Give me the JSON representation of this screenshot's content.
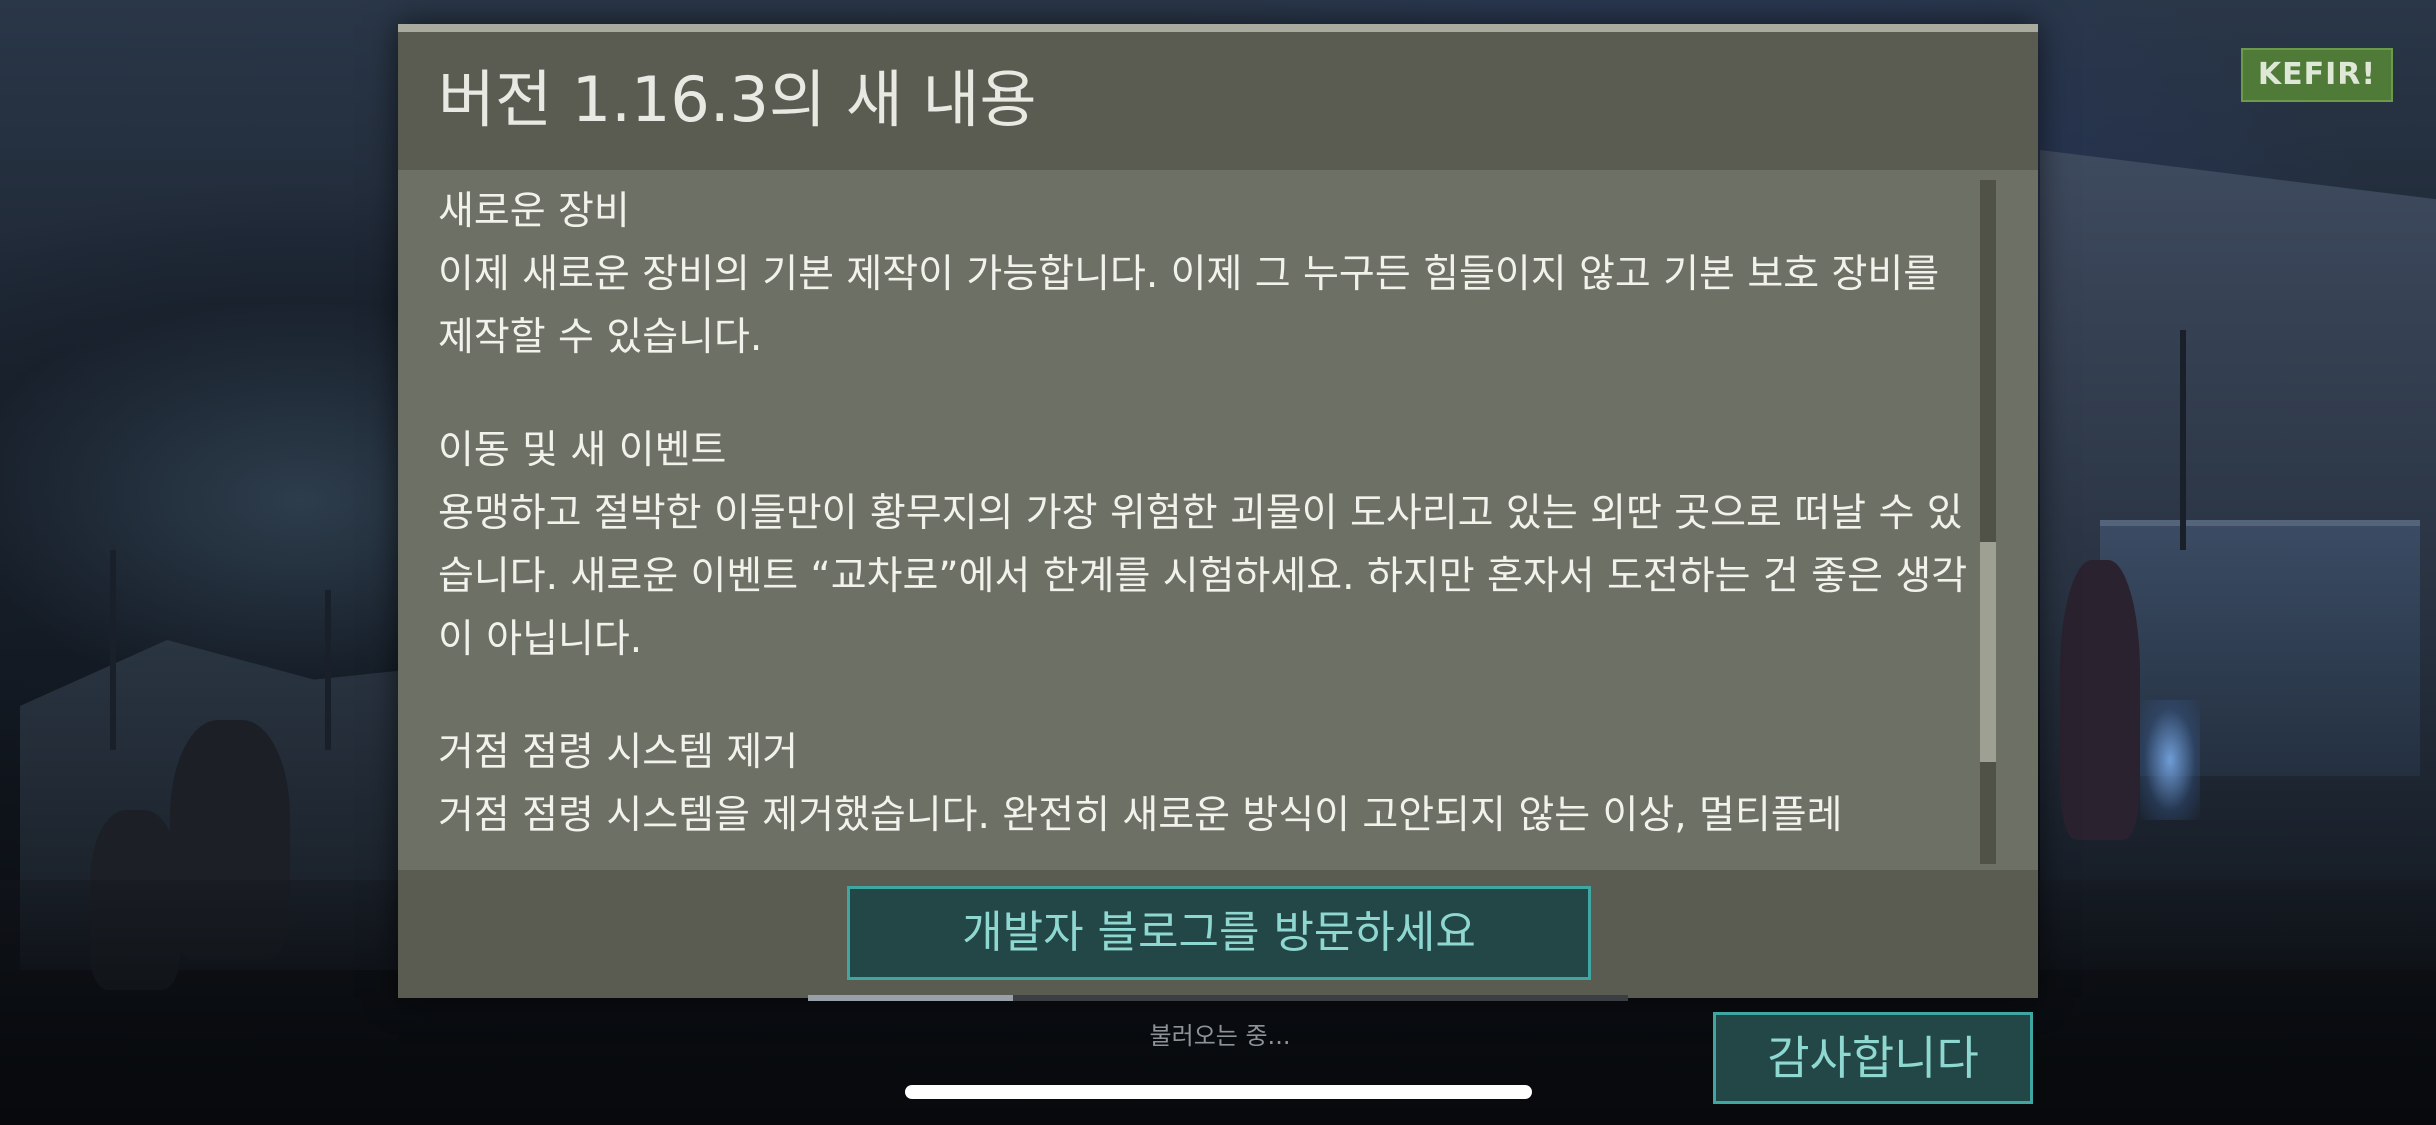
{
  "logo": {
    "text": "KEFIR!"
  },
  "dialog": {
    "title": "버전 1.16.3의 새 내용",
    "sections": [
      {
        "heading": "새로운 장비",
        "body": "이제 새로운 장비의 기본 제작이 가능합니다. 이제 그 누구든 힘들이지 않고 기본 보호 장비를 제작할 수 있습니다."
      },
      {
        "heading": "이동 및 새 이벤트",
        "body": "용맹하고 절박한 이들만이 황무지의 가장 위험한 괴물이 도사리고 있는 외딴 곳으로 떠날 수 있습니다. 새로운 이벤트 “교차로”에서 한계를 시험하세요. 하지만 혼자서 도전하는 건 좋은 생각이 아닙니다."
      },
      {
        "heading": "거점 점령 시스템 제거",
        "body": "거점 점령 시스템을 제거했습니다. 완전히 새로운 방식이 고안되지 않는 이상, 멀티플레"
      }
    ],
    "scroll_position": 0.55,
    "blog_button_label": "개발자 블로그를 방문하세요"
  },
  "loading": {
    "text": "불러오는 중...",
    "progress": 0.25
  },
  "thanks_button_label": "감사합니다"
}
